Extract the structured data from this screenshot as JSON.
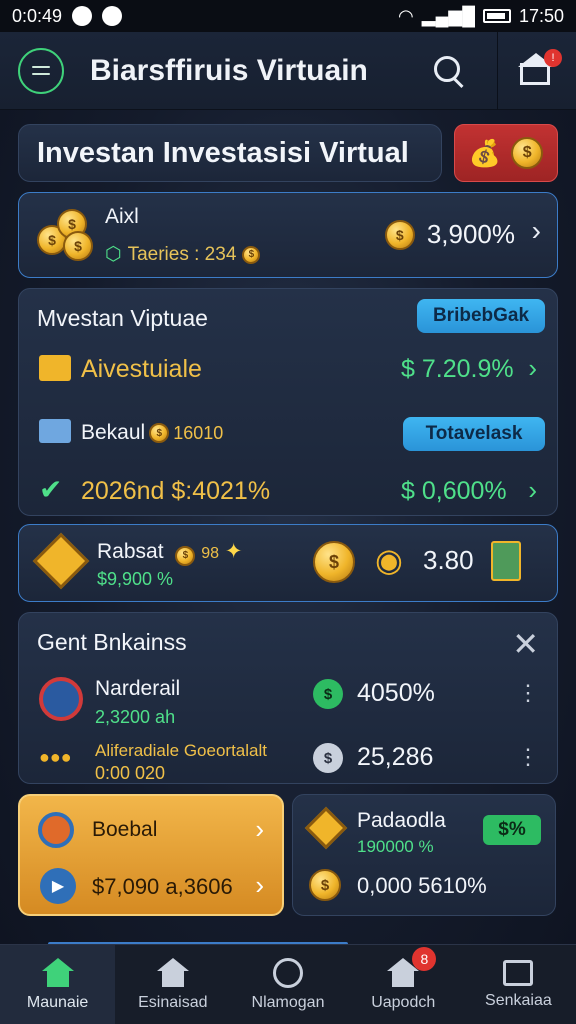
{
  "status_bar": {
    "time_left": "0:0:49",
    "time_right": "17:50"
  },
  "header": {
    "title": "Biarsffiruis Virtuain"
  },
  "title_card": {
    "title": "Investan Investasisi Virtual"
  },
  "account": {
    "name": "Aixl",
    "sub": "Taeries : 234",
    "value": "3,900%"
  },
  "investment": {
    "title": "Mvestan Viptuae",
    "pill_top": "BribebGak",
    "row1_label": "Aivestuiale",
    "row1_value": "$ 7.20.9%",
    "row2_label": "Bekaul",
    "row2_coin_value": "16010",
    "pill_bottom": "Totavelask",
    "row3_label": "2026nd $:4021%",
    "row3_value": "$ 0,600%"
  },
  "rabsat": {
    "name": "Rabsat",
    "tag": "98",
    "sub": "$9,900 %",
    "value": "3.80"
  },
  "gent": {
    "title": "Gent Bnkainss",
    "rows": [
      {
        "name": "Narderail",
        "sub": "2,3200 ah",
        "value": "4050%"
      },
      {
        "name": "Aliferadiale Goeortalalt",
        "sub": "0:00 020",
        "value": "25,286"
      }
    ]
  },
  "boebal": {
    "title": "Boebal",
    "value": "$7,090 a,3606"
  },
  "padaodla": {
    "title": "Padaodla",
    "sub": "190000 %",
    "pill": "$%",
    "value": "0,000 5610%"
  },
  "bottom_nav": {
    "items": [
      {
        "label": "Maunaie"
      },
      {
        "label": "Esinaisad"
      },
      {
        "label": "Nlamogan"
      },
      {
        "label": "Uapodch",
        "badge": "8"
      },
      {
        "label": "Senkaiaa"
      }
    ]
  },
  "colors": {
    "accent_green": "#4fe08a",
    "accent_blue": "#3fb6f1",
    "gold": "#f0b52a",
    "alert_red": "#e0342f"
  }
}
